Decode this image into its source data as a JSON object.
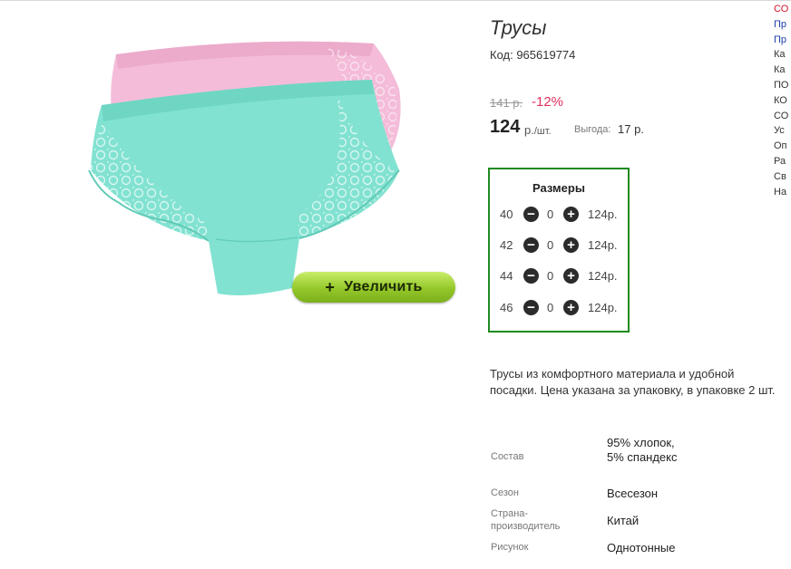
{
  "product": {
    "title": "Трусы",
    "code": "Код: 965619774",
    "old_price": "141 р.",
    "discount": "-12%",
    "price": "124",
    "unit_main": "р.",
    "unit_per": "/шт.",
    "benefit_label": "Выгода:",
    "benefit_value": "17 р.",
    "zoom_label": "Увеличить",
    "zoom_icon": "+"
  },
  "sizes": {
    "title": "Размеры",
    "rows": [
      {
        "size": "40",
        "qty": "0",
        "price": "124р."
      },
      {
        "size": "42",
        "qty": "0",
        "price": "124р."
      },
      {
        "size": "44",
        "qty": "0",
        "price": "124р."
      },
      {
        "size": "46",
        "qty": "0",
        "price": "124р."
      }
    ]
  },
  "description": "Трусы из комфортного материала и удобной посадки. Цена указана за упаковку, в упаковке 2 шт.",
  "properties": [
    {
      "label": "Состав",
      "value": "95% хлопок, 5% спандекс"
    },
    {
      "label": "Сезон",
      "value": "Всесезон"
    },
    {
      "label": "Страна-производитель",
      "value": "Китай"
    },
    {
      "label": "Рисунок",
      "value": "Однотонные"
    }
  ],
  "right_column": [
    "СО",
    "Пр",
    "Пр",
    "Ка",
    "Ка",
    "ПО",
    "КО",
    "СО",
    "Ус",
    "Оп",
    "Ра",
    "Св",
    "На"
  ],
  "colors": {
    "accent_red": "#e0305c",
    "sizes_border": "#1f8a1f",
    "zoom_button": "#94c729",
    "panty_pink": "#f2b8d6",
    "panty_mint": "#7fe0cf"
  }
}
